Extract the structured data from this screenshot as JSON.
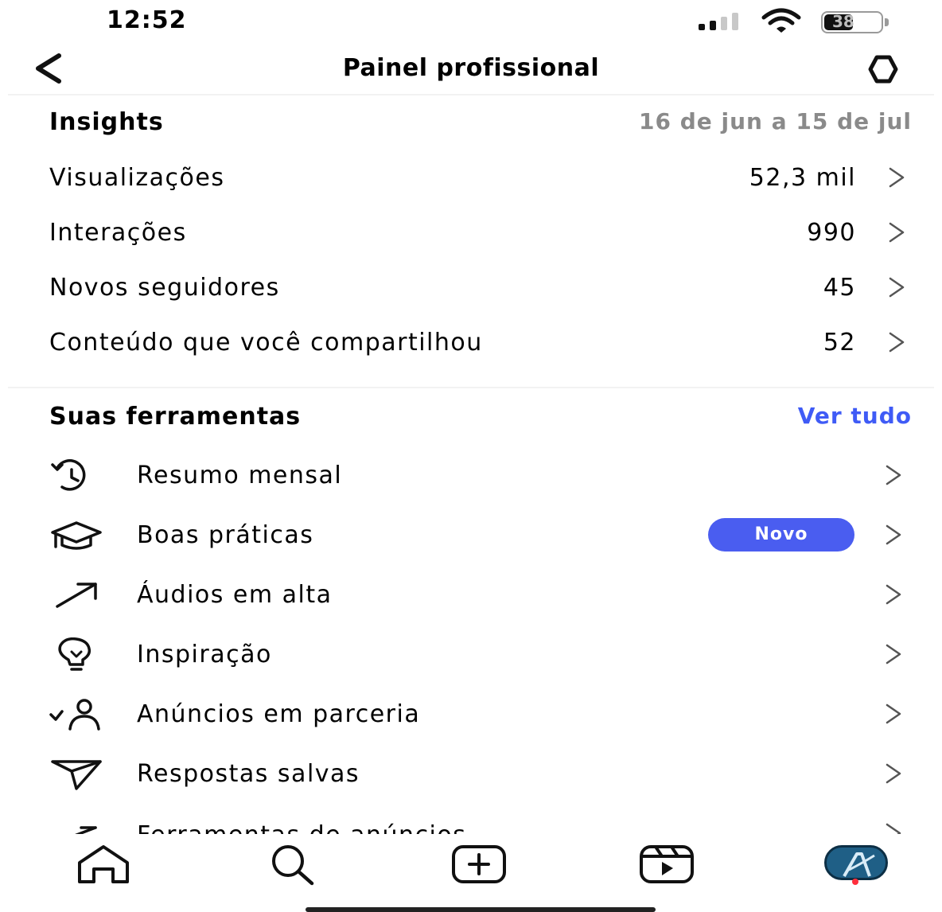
{
  "status_bar": {
    "time": "12:52",
    "battery_level": "38"
  },
  "header": {
    "title": "Painel profissional",
    "back_icon": "chevron-left-icon",
    "settings_icon": "gear-icon"
  },
  "insights": {
    "title": "Insights",
    "date_range": "16 de jun a 15 de jul",
    "rows": [
      {
        "label": "Visualizações",
        "value": "52,3 mil"
      },
      {
        "label": "Interações",
        "value": "990"
      },
      {
        "label": "Novos seguidores",
        "value": "45"
      },
      {
        "label": "Conteúdo que você compartilhou",
        "value": "52"
      }
    ]
  },
  "tools": {
    "title": "Suas ferramentas",
    "see_all": "Ver tudo",
    "items": [
      {
        "label": "Resumo mensal",
        "icon": "history-clock-icon"
      },
      {
        "label": "Boas práticas",
        "icon": "graduation-cap-icon",
        "badge": "Novo"
      },
      {
        "label": "Áudios em alta",
        "icon": "trending-arrow-icon"
      },
      {
        "label": "Inspiração",
        "icon": "lightbulb-icon"
      },
      {
        "label": "Anúncios em parceria",
        "icon": "partner-check-icon"
      },
      {
        "label": "Respostas salvas",
        "icon": "send-icon"
      },
      {
        "label": "Ferramentas de anúncios",
        "icon": "ads-arrow-icon"
      }
    ]
  },
  "tab_bar": {
    "tabs": [
      "home-icon",
      "search-icon",
      "create-icon",
      "reels-icon",
      "profile-avatar"
    ]
  },
  "colors": {
    "accent": "#3f5bf6",
    "badge": "#4a5df0",
    "muted_text": "#8a8a8a",
    "notification_dot": "#ff2e3c"
  }
}
